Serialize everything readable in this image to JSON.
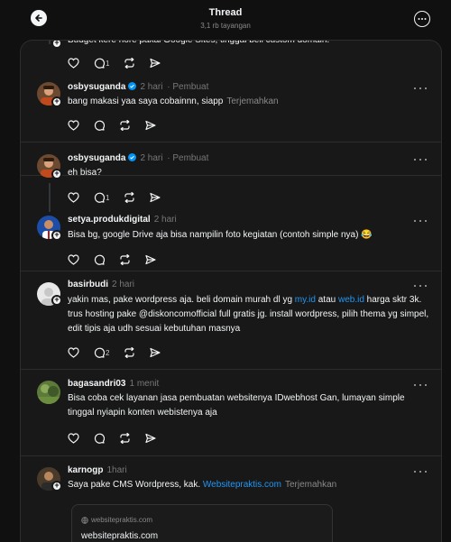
{
  "header": {
    "title": "Thread",
    "views": "3,1 rb tayangan"
  },
  "top_snippet": {
    "text": "Budget kere hore pakai Google Sites, tinggal beli custom domain.",
    "repost_count": "1"
  },
  "posts": [
    {
      "username": "osbysuganda",
      "verified": true,
      "time": "2 hari",
      "tag": "· Pembuat",
      "text": "bang makasi yaa saya cobainnn, siapp",
      "translate": "Terjemahkan",
      "reply_count": ""
    },
    {
      "username": "osbysuganda",
      "verified": true,
      "time": "2 hari",
      "tag": "· Pembuat",
      "text": "eh bisa?",
      "reply_count": "1"
    },
    {
      "username": "setya.produkdigital",
      "time": "2 hari",
      "text": "Bisa bg, google Drive aja bisa nampilin foto kegiatan (contoh simple nya) 😂"
    },
    {
      "username": "basirbudi",
      "time": "2 hari",
      "text_part1": "yakin mas, pake wordpress aja. beli domain murah dl yg ",
      "link1": "my.id",
      "text_part2": " atau ",
      "link2": "web.id",
      "text_part3": " harga sktr 3k. trus hosting pake @diskoncomofficial full gratis jg. install wordpress, pilih thema yg simpel, edit tipis aja udh sesuai kebutuhan masnya",
      "reply_count": "2"
    },
    {
      "username": "bagasandri03",
      "time": "1 menit",
      "text": "Bisa coba cek layanan jasa pembuatan websitenya IDwebhost Gan, lumayan simple tinggal nyiapin konten webistenya aja"
    },
    {
      "username": "karnogp",
      "time": "1hari",
      "text": "Saya pake CMS Wordpress, kak. ",
      "link": "Websitepraktis.com",
      "translate": "Terjemahkan",
      "preview": {
        "domain": "websitepraktis.com",
        "title": "websitepraktis.com"
      }
    }
  ],
  "colors": {
    "background": "#101010",
    "card": "#181818",
    "link": "#2196f3",
    "verified": "#0095f6"
  }
}
